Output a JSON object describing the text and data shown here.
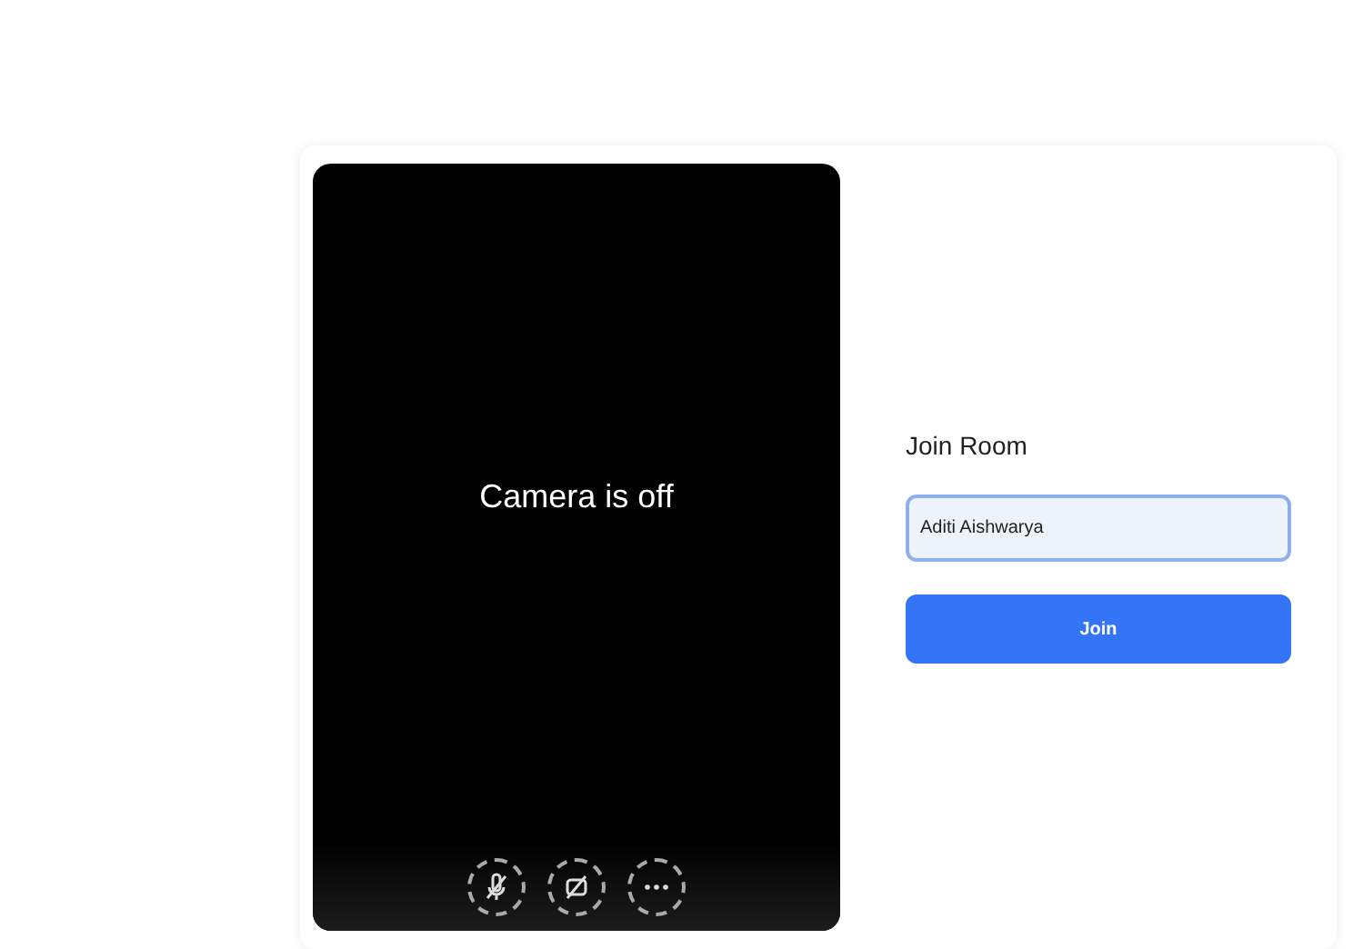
{
  "preview": {
    "message": "Camera is off",
    "controls": [
      {
        "kind": "mic",
        "muted": true
      },
      {
        "kind": "camera",
        "muted": true
      },
      {
        "kind": "more"
      }
    ]
  },
  "join": {
    "title": "Join Room",
    "name_value": "Aditi Aishwarya",
    "button": "Join"
  }
}
